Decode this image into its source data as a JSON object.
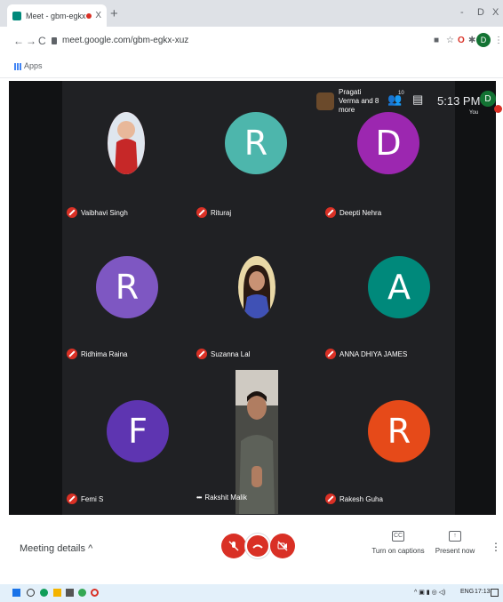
{
  "browser": {
    "tab_title": "Meet - gbm-egkx-xuz",
    "tab_close": "X",
    "new_tab": "+",
    "url": "meet.google.com/gbm-egkx-xuz",
    "bookmark_apps": "Apps",
    "profile_initial": "D",
    "window_controls": {
      "minimize": "-",
      "maximize": "D",
      "close": "X"
    }
  },
  "meet": {
    "presenter": "Pragati Verma and 8 more",
    "people_count": "10",
    "clock": "5:13 PM",
    "self_initial": "D",
    "self_label": "You",
    "participants": [
      {
        "name": "Vaibhavi Singh",
        "initial": "",
        "color": "#f28b82",
        "photo": true
      },
      {
        "name": "Rituraj",
        "initial": "R",
        "color": "#4db6ac",
        "photo": false
      },
      {
        "name": "Deepti Nehra",
        "initial": "D",
        "color": "#9c27b0",
        "photo": false
      },
      {
        "name": "Ridhima Raina",
        "initial": "R",
        "color": "#7e57c2",
        "photo": false
      },
      {
        "name": "Suzanna Lal",
        "initial": "",
        "color": "#5c6bc0",
        "photo": true
      },
      {
        "name": "ANNA DHIYA JAMES",
        "initial": "A",
        "color": "#00897b",
        "photo": false
      },
      {
        "name": "Femi S",
        "initial": "F",
        "color": "#5e35b1",
        "photo": false
      },
      {
        "name": "Rakshit Malik",
        "initial": "",
        "color": "#3a3a38",
        "photo": true
      },
      {
        "name": "Rakesh Guha",
        "initial": "R",
        "color": "#e64a19",
        "photo": false
      }
    ]
  },
  "controls": {
    "meeting_details": "Meeting details",
    "captions": "Turn on captions",
    "present": "Present now"
  },
  "taskbar": {
    "lang": "ENG",
    "time": "17:13"
  }
}
